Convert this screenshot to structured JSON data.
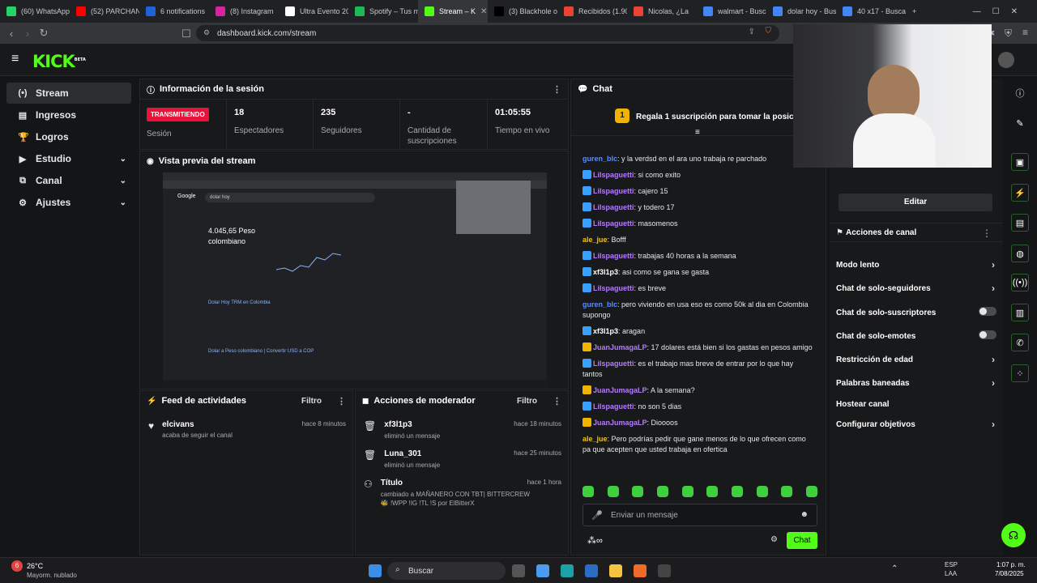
{
  "browser": {
    "tabs": [
      {
        "label": "(60) WhatsApp",
        "color": "#25d366"
      },
      {
        "label": "(52) PARCHAN",
        "color": "#ff0000"
      },
      {
        "label": "6 notifications",
        "color": "#1d63d8"
      },
      {
        "label": "(8) Instagram",
        "color": "#d6249f"
      },
      {
        "label": "Ultra Evento 20",
        "color": "#ffffff"
      },
      {
        "label": "Spotify – Tus m",
        "color": "#1db954"
      },
      {
        "label": "Stream – K",
        "color": "#53fc18",
        "active": true
      },
      {
        "label": "(3) Blackhole o",
        "color": "#000000"
      },
      {
        "label": "Recibidos (1.90",
        "color": "#ea4335"
      },
      {
        "label": "Nicolas, ¿La",
        "color": "#ea4335"
      },
      {
        "label": "walmart - Busca",
        "color": "#4285f4"
      },
      {
        "label": "dolar hoy - Bus",
        "color": "#4285f4"
      },
      {
        "label": "40 x17 - Buscar",
        "color": "#4285f4"
      }
    ],
    "new_tab": "+",
    "url": "dashboard.kick.com/stream"
  },
  "app": {
    "logo": "KICK",
    "logo_sup": "BETA"
  },
  "sidebar": {
    "items": [
      {
        "label": "Stream",
        "icon": "(•)",
        "active": true
      },
      {
        "label": "Ingresos",
        "icon": "▤"
      },
      {
        "label": "Logros",
        "icon": "🏆"
      },
      {
        "label": "Estudio",
        "icon": "▶",
        "expand": "⌄"
      },
      {
        "label": "Canal",
        "icon": "⧉",
        "expand": "⌄"
      },
      {
        "label": "Ajustes",
        "icon": "⚙",
        "expand": "⌄"
      }
    ]
  },
  "session": {
    "title": "Información de la sesión",
    "live_badge": "TRANSMITIENDO",
    "live_label": "Sesión",
    "stats": [
      {
        "value": "18",
        "label": "Espectadores"
      },
      {
        "value": "235",
        "label": "Seguidores"
      },
      {
        "value": "-",
        "label": "Cantidad de suscripciones"
      },
      {
        "value": "01:05:55",
        "label": "Tiempo en vivo"
      }
    ]
  },
  "preview": {
    "title": "Vista previa del stream",
    "inner": {
      "search": "dolar hoy",
      "value": "4.045,65 Peso",
      "currency": "colombiano",
      "link": "Dolar Hoy TRM en Colombia",
      "link2": "Dolar a Peso colombiano | Convertir USD a COP"
    }
  },
  "activity": {
    "title": "Feed de actividades",
    "filter": "Filtro",
    "items": [
      {
        "name": "elcivans",
        "desc": "acaba de seguir el canal",
        "time": "hace 8 minutos"
      }
    ]
  },
  "mod_actions": {
    "title": "Acciones de moderador",
    "filter": "Filtro",
    "items": [
      {
        "name": "xf3l1p3",
        "desc": "eliminó un mensaje",
        "time": "hace 18 minutos"
      },
      {
        "name": "Luna_301",
        "desc": "eliminó un mensaje",
        "time": "hace 25 minutos"
      },
      {
        "name": "Título",
        "desc": "cambiado a MAÑANERO CON TBT| BITTERCREW 🐝 !WPP !IG !TL !S por ElBitterX",
        "time": "hace 1 hora"
      }
    ]
  },
  "chat": {
    "title": "Chat",
    "pinned": "Regala 1 suscripción para tomar la posición 1",
    "pinned_rank": "1",
    "messages": [
      {
        "user": "guren_blc",
        "color": "#5b8cff",
        "text": "y la verdsd en el ara uno trabaja re parchado"
      },
      {
        "user": "Lilspaguetti",
        "color": "#b57bff",
        "badge": "#3aa0ff",
        "text": "si como exito"
      },
      {
        "user": "Lilspaguetti",
        "color": "#b57bff",
        "badge": "#3aa0ff",
        "text": "cajero 15"
      },
      {
        "user": "Lilspaguetti",
        "color": "#b57bff",
        "badge": "#3aa0ff",
        "text": "y todero 17"
      },
      {
        "user": "Lilspaguetti",
        "color": "#b57bff",
        "badge": "#3aa0ff",
        "text": "masomenos"
      },
      {
        "user": "ale_jue",
        "color": "#f1c40f",
        "text": "Bofff"
      },
      {
        "user": "Lilspaguetti",
        "color": "#b57bff",
        "badge": "#3aa0ff",
        "text": "trabajas 40 horas a la semana"
      },
      {
        "user": "xf3l1p3",
        "color": "#ffffff",
        "badge": "#3aa0ff",
        "text": "asi como se gana se gasta"
      },
      {
        "user": "Lilspaguetti",
        "color": "#b57bff",
        "badge": "#3aa0ff",
        "text": "es breve"
      },
      {
        "user": "guren_blc",
        "color": "#5b8cff",
        "text": "pero viviendo en usa eso es como 50k al dia en Colombia supongo"
      },
      {
        "user": "xf3l1p3",
        "color": "#ffffff",
        "badge": "#3aa0ff",
        "text": "aragan"
      },
      {
        "user": "JuanJumagaLP",
        "color": "#b57bff",
        "badge": "#f0b400",
        "text": "17 dolares está bien si los gastas en pesos amigo"
      },
      {
        "user": "Lilspaguetti",
        "color": "#b57bff",
        "badge": "#3aa0ff",
        "text": "es el trabajo mas breve de entrar por lo que hay tantos"
      },
      {
        "user": "JuanJumagaLP",
        "color": "#b57bff",
        "badge": "#f0b400",
        "text": "A la semana?"
      },
      {
        "user": "Lilspaguetti",
        "color": "#b57bff",
        "badge": "#3aa0ff",
        "text": "no son 5 dias"
      },
      {
        "user": "JuanJumagaLP",
        "color": "#b57bff",
        "badge": "#f0b400",
        "text": "Dioooos"
      },
      {
        "user": "ale_jue",
        "color": "#f1c40f",
        "text": "Pero podrías pedir que gane menos de lo que ofrecen como pa que acepten que usted trabaja en ofertica"
      }
    ],
    "input_placeholder": "Enviar un mensaje",
    "send_label": "Chat"
  },
  "right_panel": {
    "edit_label": "Editar",
    "actions_title": "Acciones de canal",
    "settings": [
      {
        "label": "Modo lento",
        "type": "chev"
      },
      {
        "label": "Chat de solo-seguidores",
        "type": "chev"
      },
      {
        "label": "Chat de solo-suscriptores",
        "type": "toggle"
      },
      {
        "label": "Chat de solo-emotes",
        "type": "toggle"
      },
      {
        "label": "Restricción de edad",
        "type": "chev"
      },
      {
        "label": "Palabras baneadas",
        "type": "chev"
      },
      {
        "label": "Hostear canal",
        "type": "none"
      },
      {
        "label": "Configurar objetivos",
        "type": "chev"
      }
    ]
  },
  "taskbar": {
    "weather_temp": "26°C",
    "weather_desc": "Mayorm. nublado",
    "weather_badge": "6",
    "search": "Buscar",
    "lang1": "ESP",
    "lang2": "LAA",
    "time": "1:07 p. m.",
    "date": "7/08/2025"
  }
}
